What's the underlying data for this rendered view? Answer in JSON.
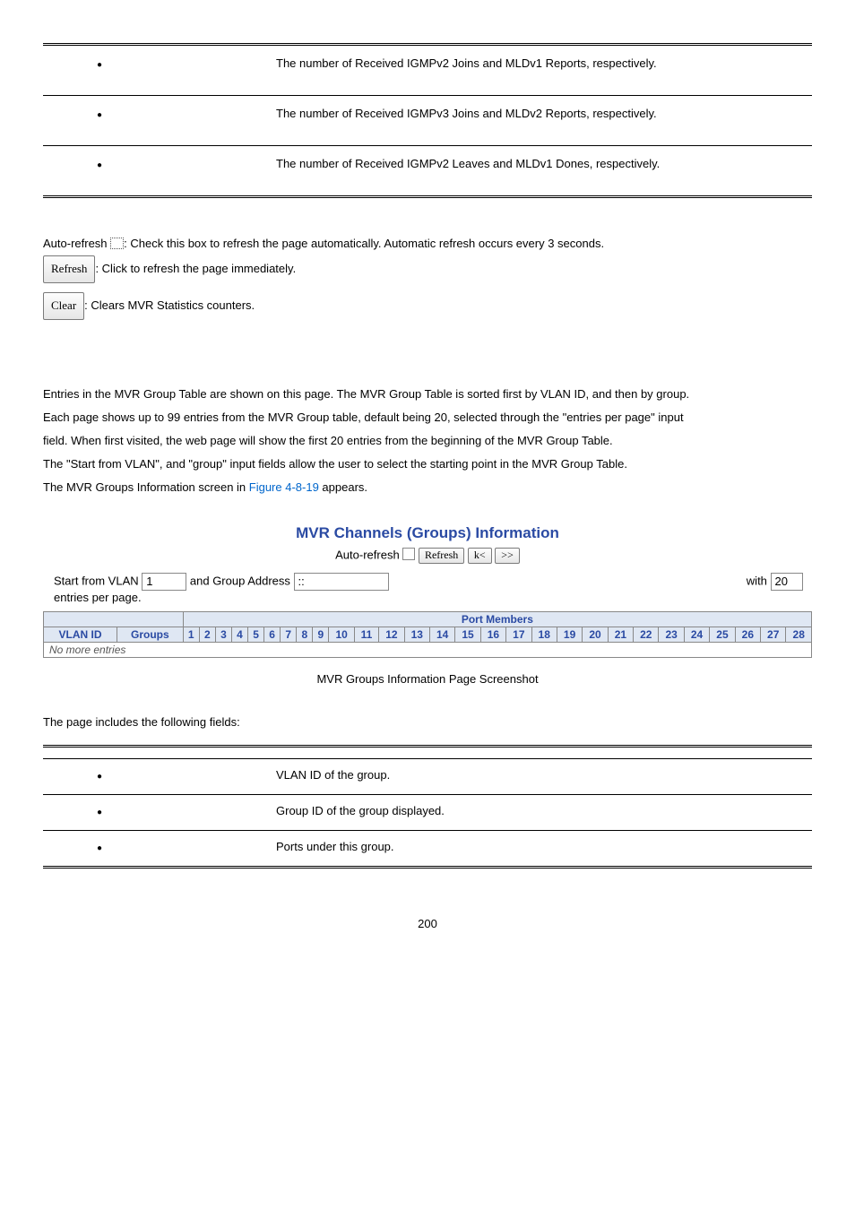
{
  "stats_table": {
    "rows": [
      {
        "desc": "The number of Received IGMPv2 Joins and MLDv1 Reports, respectively."
      },
      {
        "desc": "The number of Received IGMPv3 Joins and MLDv2 Reports, respectively."
      },
      {
        "desc": "The number of Received IGMPv2 Leaves and MLDv1 Dones, respectively."
      }
    ]
  },
  "controls": {
    "auto_refresh_label": "Auto-refresh",
    "auto_refresh_sentence_before": ": Check this box to refresh the page automatically. Automatic refresh occurs every 3 seconds.",
    "refresh_btn": "Refresh",
    "refresh_sentence": ": Click to refresh the page immediately.",
    "clear_btn": "Clear",
    "clear_sentence": ": Clears MVR Statistics counters."
  },
  "section_intro": {
    "p1": "Entries in the MVR Group Table are shown on this page. The MVR Group Table is sorted first by VLAN ID, and then by group.",
    "p2": "Each page shows up to 99 entries from the MVR Group table, default being 20, selected through the \"entries per page\" input",
    "p3": "field. When first visited, the web page will show the first 20 entries from the beginning of the MVR Group Table.",
    "p4": "The \"Start from VLAN\", and \"group\" input fields allow the user to select the starting point in the MVR Group Table.",
    "p5_a": "The MVR Groups Information screen in ",
    "p5_link": "Figure 4-8-19",
    "p5_b": " appears."
  },
  "figure": {
    "title": "MVR Channels (Groups) Information",
    "toolbar": {
      "auto_refresh_label": "Auto-refresh",
      "refresh_btn": "Refresh",
      "first_btn": "k<",
      "next_btn": ">>"
    },
    "filter": {
      "start_from_label": "Start from VLAN",
      "vlan_value": "1",
      "and_group_label": "and Group Address",
      "group_value": "::",
      "with_label": "with",
      "entries_value": "20",
      "entries_suffix": "entries per page."
    },
    "grid": {
      "port_members_label": "Port Members",
      "cols_fixed": [
        "VLAN ID",
        "Groups"
      ],
      "ports": [
        "1",
        "2",
        "3",
        "4",
        "5",
        "6",
        "7",
        "8",
        "9",
        "10",
        "11",
        "12",
        "13",
        "14",
        "15",
        "16",
        "17",
        "18",
        "19",
        "20",
        "21",
        "22",
        "23",
        "24",
        "25",
        "26",
        "27",
        "28"
      ],
      "no_more": "No more entries"
    },
    "caption": "MVR Groups Information Page Screenshot"
  },
  "fields_intro": "The page includes the following fields:",
  "fields_table": {
    "rows": [
      {
        "desc": "VLAN ID of the group."
      },
      {
        "desc": "Group ID of the group displayed."
      },
      {
        "desc": "Ports under this group."
      }
    ]
  },
  "page_number": "200"
}
